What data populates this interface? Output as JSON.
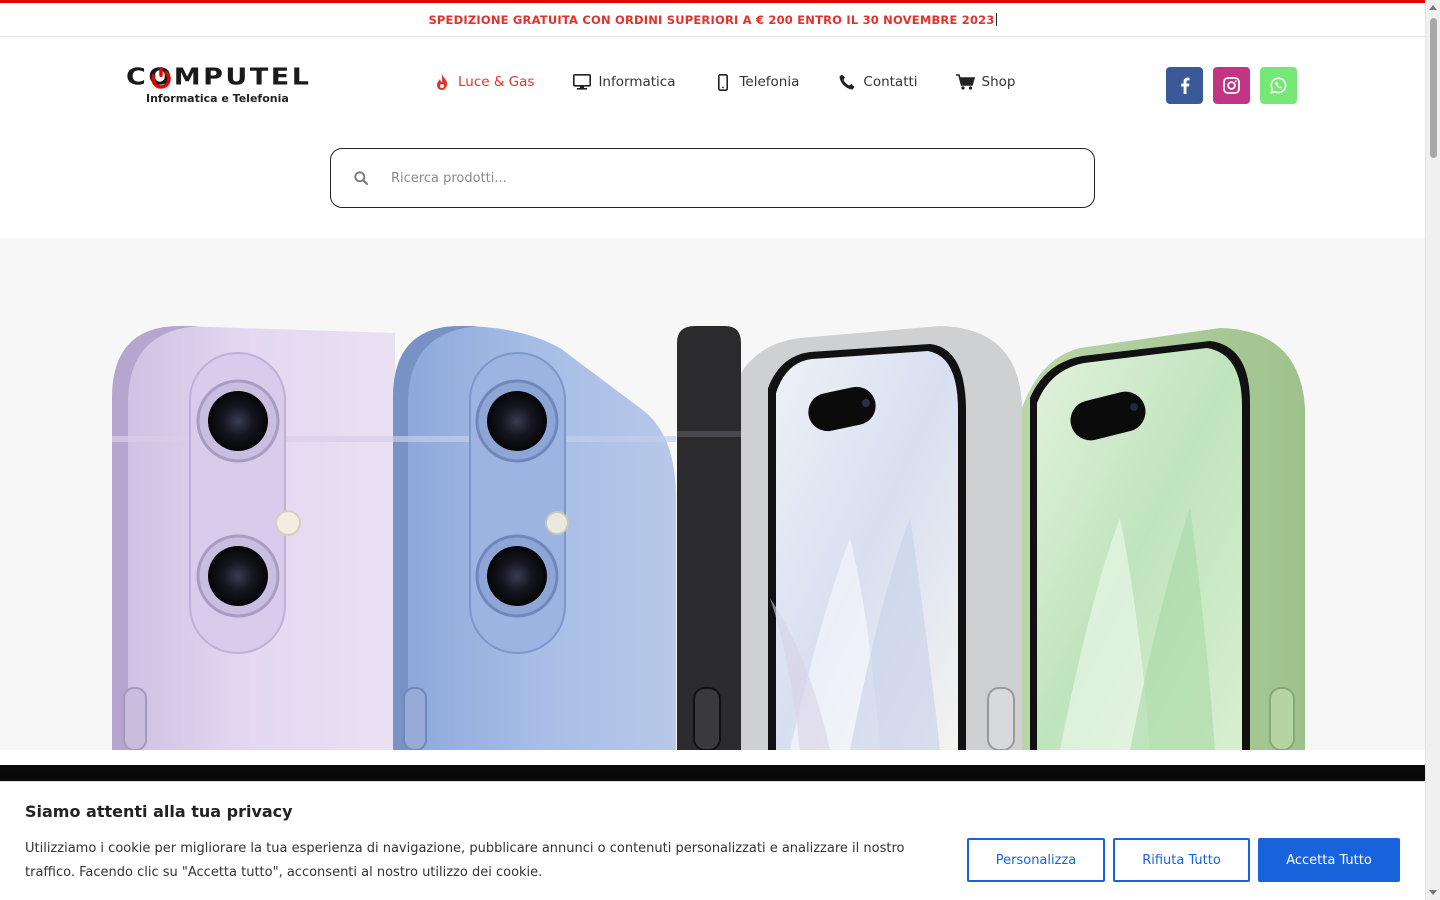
{
  "promo": {
    "text": "SPEDIZIONE GRATUITA CON ORDINI SUPERIORI A € 200 ENTRO IL 30 NOVEMBRE 2023"
  },
  "logo": {
    "name": "COMPUTEL",
    "subtitle": "Informatica e Telefonia"
  },
  "nav": [
    {
      "label": "Luce & Gas",
      "icon": "flame-icon"
    },
    {
      "label": "Informatica",
      "icon": "monitor-icon"
    },
    {
      "label": "Telefonia",
      "icon": "phone-device-icon"
    },
    {
      "label": "Contatti",
      "icon": "phone-call-icon"
    },
    {
      "label": "Shop",
      "icon": "cart-icon"
    }
  ],
  "social": [
    {
      "name": "facebook",
      "color": "#3b5998"
    },
    {
      "name": "instagram",
      "color": "#c13584"
    },
    {
      "name": "whatsapp",
      "color": "#77e878"
    }
  ],
  "search": {
    "placeholder": "Ricerca prodotti..."
  },
  "cookie": {
    "title": "Siamo attenti alla tua privacy",
    "text": "Utilizziamo i cookie per migliorare la tua esperienza di navigazione, pubblicare annunci o contenuti personalizzati e analizzare il nostro traffico. Facendo clic su \"Accetta tutto\", acconsenti al nostro utilizzo dei cookie.",
    "customize_label": "Personalizza",
    "reject_label": "Rifiuta Tutto",
    "accept_label": "Accetta Tutto"
  },
  "colors": {
    "accent_red": "#e4312b",
    "cookie_blue": "#1863dc"
  }
}
